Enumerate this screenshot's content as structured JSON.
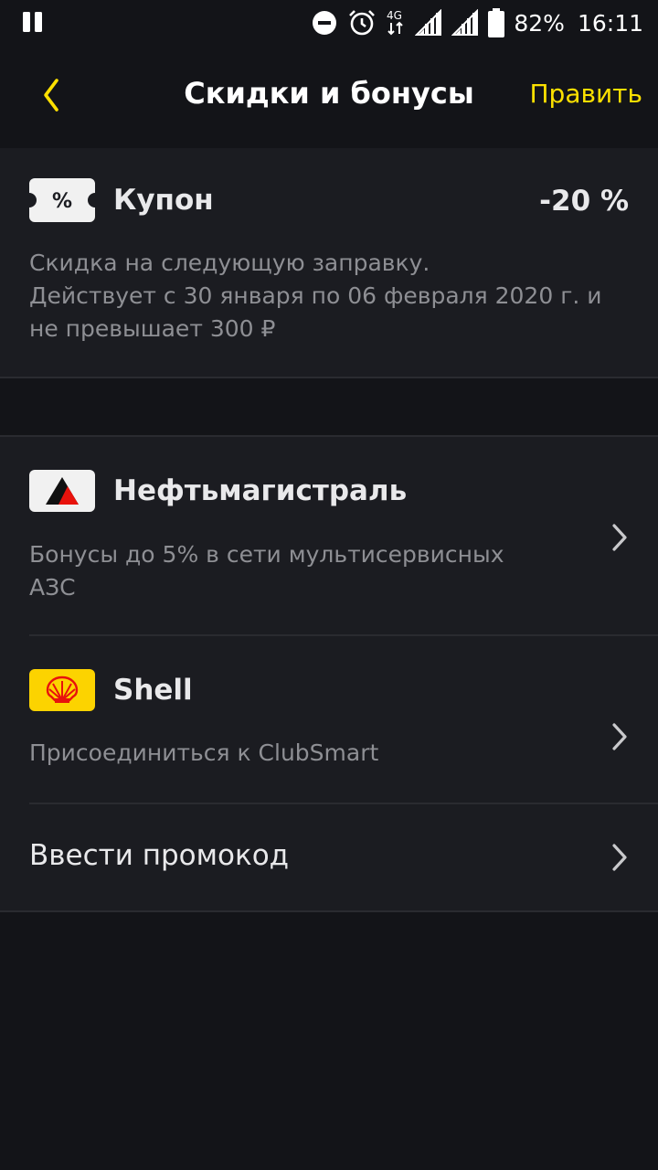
{
  "status_bar": {
    "battery": "82%",
    "time": "16:11",
    "network": "4G",
    "icons": [
      "pause-icon",
      "do-not-disturb-icon",
      "alarm-icon",
      "network-4g-icon",
      "signal-icon",
      "signal-icon",
      "battery-icon"
    ]
  },
  "header": {
    "title": "Скидки и бонусы",
    "edit_label": "Править",
    "accent_color": "#fce000"
  },
  "coupon": {
    "badge_symbol": "%",
    "title": "Купон",
    "value": "-20 %",
    "description_line1": "Скидка на следующую заправку.",
    "description_line2": "Действует с 30 января по 06 февраля 2020 г. и",
    "description_line3": "не превышает 300 ₽"
  },
  "programs": [
    {
      "title": "Нефтьмагистраль",
      "description_line1": "Бонусы до 5% в сети мультисервисных",
      "description_line2": "АЗС",
      "logo": "neftmagistral-logo"
    },
    {
      "title": "Shell",
      "description_line1": "Присоединиться к ClubSmart",
      "logo": "shell-logo"
    }
  ],
  "promo": {
    "label": "Ввести промокод"
  },
  "colors": {
    "background": "#131418",
    "card": "#1b1c21",
    "muted_text": "#8e8f94",
    "shell_yellow": "#fcd300",
    "neft_red": "#e8120c"
  }
}
